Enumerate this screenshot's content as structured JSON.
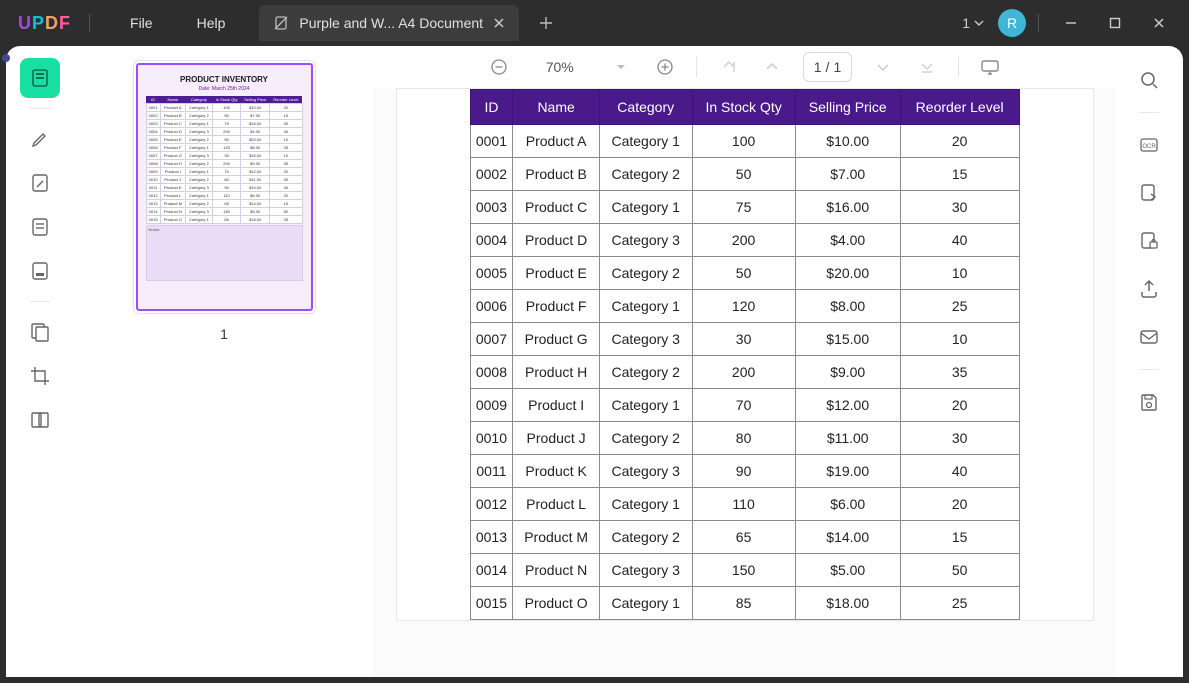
{
  "menubar": {
    "file": "File",
    "help": "Help"
  },
  "tab": {
    "title": "Purple and W... A4 Document"
  },
  "titlebar": {
    "window_count": "1",
    "avatar_initial": "R"
  },
  "view_toolbar": {
    "zoom_label": "70%",
    "page_indicator_current": "1",
    "page_indicator_sep": "/",
    "page_indicator_total": "1"
  },
  "thumbnail": {
    "page_label": "1",
    "doc_title": "PRODUCT INVENTORY",
    "doc_subtitle": "Date: March 25th 2024",
    "notes_label": "Notes:"
  },
  "inventory": {
    "headers": [
      "ID",
      "Name",
      "Category",
      "In Stock Qty",
      "Selling Price",
      "Reorder Level"
    ],
    "rows": [
      {
        "id": "0001",
        "name": "Product A",
        "category": "Category 1",
        "qty": "100",
        "price": "$10.00",
        "reorder": "20"
      },
      {
        "id": "0002",
        "name": "Product B",
        "category": "Category 2",
        "qty": "50",
        "price": "$7.00",
        "reorder": "15"
      },
      {
        "id": "0003",
        "name": "Product C",
        "category": "Category 1",
        "qty": "75",
        "price": "$16.00",
        "reorder": "30"
      },
      {
        "id": "0004",
        "name": "Product D",
        "category": "Category 3",
        "qty": "200",
        "price": "$4.00",
        "reorder": "40"
      },
      {
        "id": "0005",
        "name": "Product E",
        "category": "Category 2",
        "qty": "50",
        "price": "$20.00",
        "reorder": "10"
      },
      {
        "id": "0006",
        "name": "Product F",
        "category": "Category 1",
        "qty": "120",
        "price": "$8.00",
        "reorder": "25"
      },
      {
        "id": "0007",
        "name": "Product G",
        "category": "Category 3",
        "qty": "30",
        "price": "$15.00",
        "reorder": "10"
      },
      {
        "id": "0008",
        "name": "Product H",
        "category": "Category 2",
        "qty": "200",
        "price": "$9.00",
        "reorder": "35"
      },
      {
        "id": "0009",
        "name": "Product I",
        "category": "Category 1",
        "qty": "70",
        "price": "$12.00",
        "reorder": "20"
      },
      {
        "id": "0010",
        "name": "Product J",
        "category": "Category 2",
        "qty": "80",
        "price": "$11.00",
        "reorder": "30"
      },
      {
        "id": "0011",
        "name": "Product K",
        "category": "Category 3",
        "qty": "90",
        "price": "$19.00",
        "reorder": "40"
      },
      {
        "id": "0012",
        "name": "Product L",
        "category": "Category 1",
        "qty": "110",
        "price": "$6.00",
        "reorder": "20"
      },
      {
        "id": "0013",
        "name": "Product M",
        "category": "Category 2",
        "qty": "65",
        "price": "$14.00",
        "reorder": "15"
      },
      {
        "id": "0014",
        "name": "Product N",
        "category": "Category 3",
        "qty": "150",
        "price": "$5.00",
        "reorder": "50"
      },
      {
        "id": "0015",
        "name": "Product O",
        "category": "Category 1",
        "qty": "85",
        "price": "$18.00",
        "reorder": "25"
      }
    ]
  }
}
